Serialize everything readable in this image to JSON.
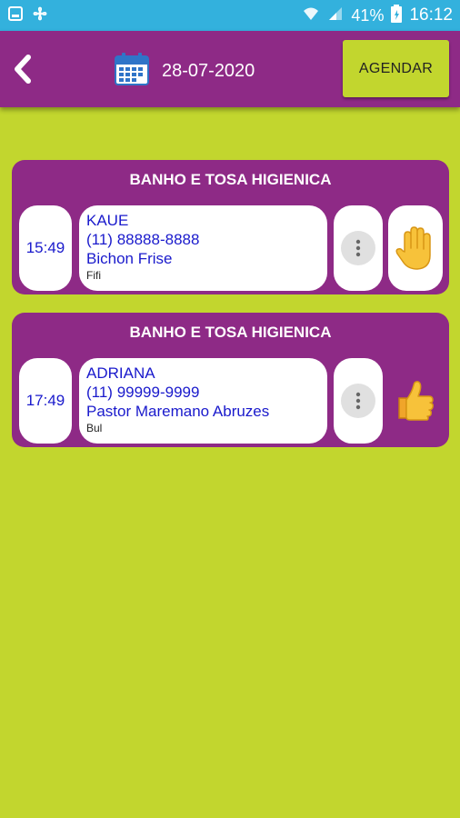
{
  "status_bar": {
    "battery": "41%",
    "time": "16:12"
  },
  "header": {
    "date": "28-07-2020",
    "agendar_label": "AGENDAR"
  },
  "appointments": [
    {
      "service": "BANHO E TOSA HIGIENICA",
      "time": "15:49",
      "client": "KAUE",
      "phone": "(11) 88888-8888",
      "breed": "Bichon Frise",
      "pet": "Fifi",
      "status_icon": "raised-hand-icon"
    },
    {
      "service": "BANHO E TOSA HIGIENICA",
      "time": "17:49",
      "client": "ADRIANA",
      "phone": "(11) 99999-9999",
      "breed": "Pastor Maremano Abruzes",
      "pet": "Bul",
      "status_icon": "thumbs-up-icon"
    }
  ],
  "colors": {
    "status_bar": "#33b1dd",
    "primary": "#8e2a86",
    "accent": "#c2d62e",
    "text_blue": "#1a1acc"
  }
}
